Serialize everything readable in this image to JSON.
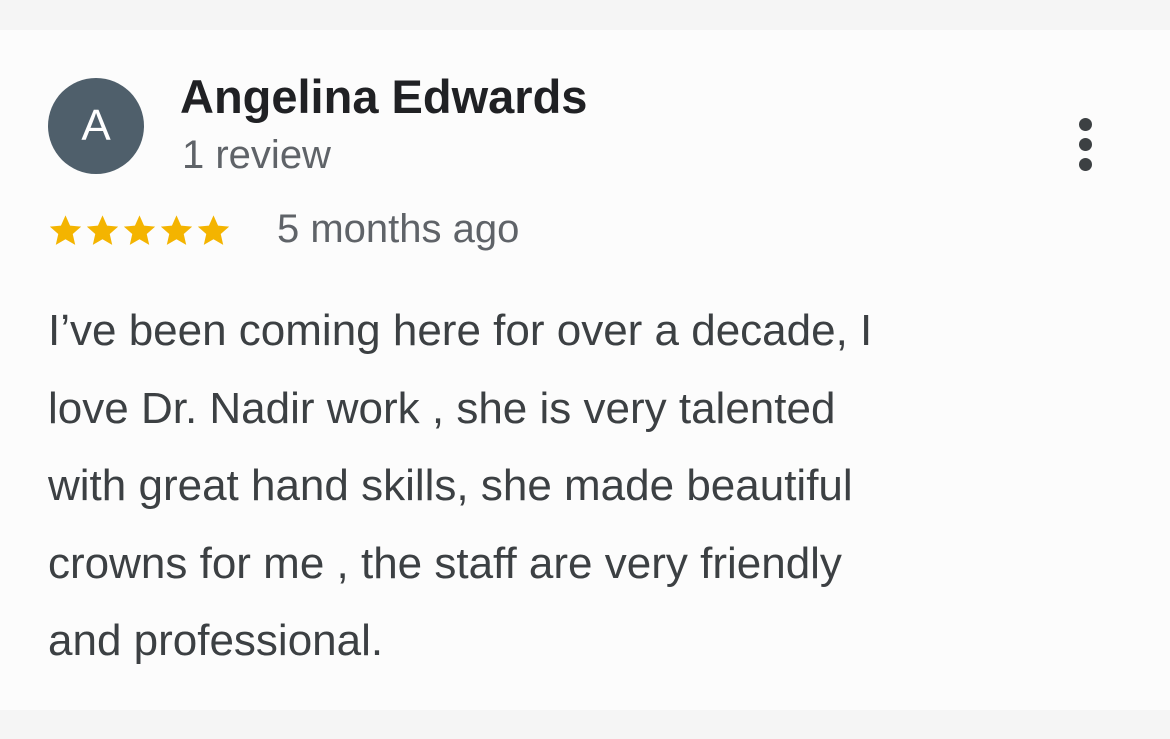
{
  "review": {
    "avatar_initial": "A",
    "reviewer_name": "Angelina Edwards",
    "review_count": "1 review",
    "rating": 5,
    "rating_max": 5,
    "time_ago": "5 months ago",
    "text_lines": [
      "I’ve been coming here for over a decade, I",
      "love Dr. Nadir work , she is very talented",
      "with great hand skills, she made beautiful",
      "crowns for me , the staff are very friendly",
      "and professional."
    ]
  },
  "icons": {
    "more": "more-vert-icon",
    "star": "star-icon"
  },
  "colors": {
    "avatar_bg": "#4f5f6b",
    "star": "#f4b400",
    "name": "#202124",
    "secondary_text": "#5f6368",
    "body_text": "#3c4043"
  }
}
